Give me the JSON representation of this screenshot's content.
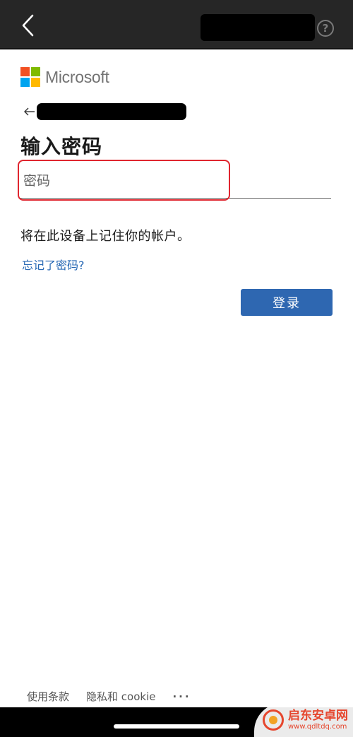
{
  "header": {
    "back_icon": "chevron-left-icon",
    "help_glyph": "?"
  },
  "brand": {
    "name": "Microsoft",
    "colors": [
      "#f25022",
      "#7fba00",
      "#00a4ef",
      "#ffb900"
    ]
  },
  "form": {
    "title": "输入密码",
    "password_placeholder": "密码",
    "password_value": "",
    "remember_text": "将在此设备上记住你的帐户。",
    "forgot_link": "忘记了密码?",
    "signin_label": "登录"
  },
  "footer": {
    "terms_label": "使用条款",
    "privacy_label": "隐私和 cookie",
    "more_label": "···"
  },
  "watermark": {
    "name": "启东安卓网",
    "url": "www.qdltdq.com"
  },
  "colors": {
    "accent": "#2e67b1",
    "link": "#2466b3",
    "highlight": "#e0262f"
  }
}
